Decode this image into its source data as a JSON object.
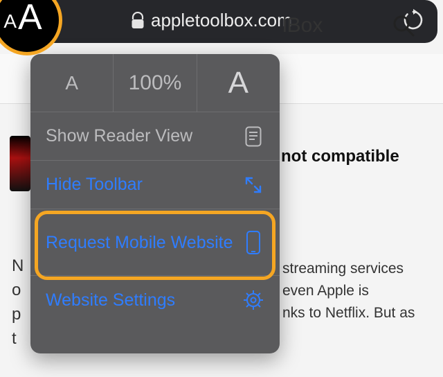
{
  "addressbar": {
    "domain": "appletoolbox.com",
    "aa_small": "A",
    "aa_large": "A"
  },
  "site": {
    "title_fragment": "lBox",
    "headline_fragment": "not compatible",
    "paragraph_fragment1": "streaming services",
    "paragraph_fragment2": "even Apple is",
    "paragraph_fragment3": "nks to Netflix. But as",
    "left_letters": [
      "N",
      "o",
      "p",
      "t"
    ]
  },
  "menu": {
    "zoom": "100%",
    "small_a": "A",
    "big_a": "A",
    "reader": "Show Reader View",
    "hide_toolbar": "Hide Toolbar",
    "request_mobile": "Request Mobile Website",
    "website_settings": "Website Settings"
  }
}
